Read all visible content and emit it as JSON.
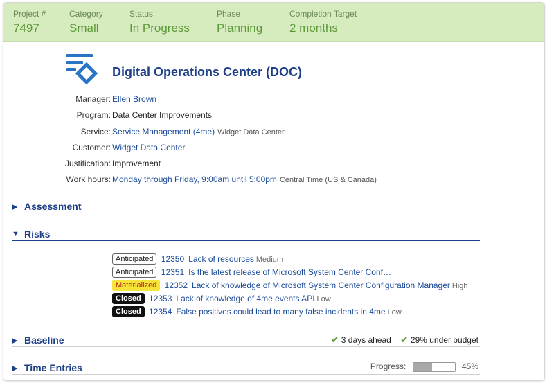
{
  "summary": {
    "project": {
      "label": "Project #",
      "value": "7497"
    },
    "category": {
      "label": "Category",
      "value": "Small"
    },
    "status": {
      "label": "Status",
      "value": "In Progress"
    },
    "phase": {
      "label": "Phase",
      "value": "Planning"
    },
    "completion": {
      "label": "Completion Target",
      "value": "2 months"
    }
  },
  "project": {
    "title": "Digital Operations Center (DOC)",
    "logo_icon": "project-logo-icon"
  },
  "details": {
    "manager": {
      "label": "Manager:",
      "value": "Ellen Brown"
    },
    "program": {
      "label": "Program:",
      "value": "Data Center Improvements"
    },
    "service": {
      "label": "Service:",
      "value": "Service Management (4me)",
      "extra": "Widget Data Center"
    },
    "customer": {
      "label": "Customer:",
      "value": "Widget Data Center"
    },
    "justification": {
      "label": "Justification:",
      "value": "Improvement"
    },
    "work_hours": {
      "label": "Work hours:",
      "value": "Monday through Friday, 9:00am until 5:00pm",
      "extra": "Central Time (US & Canada)"
    }
  },
  "sections": {
    "assessment": {
      "title": "Assessment",
      "icon": "triangle-right-icon"
    },
    "risks": {
      "title": "Risks",
      "icon": "triangle-down-icon"
    },
    "baseline": {
      "title": "Baseline",
      "icon": "triangle-right-icon"
    },
    "time_entries": {
      "title": "Time Entries",
      "icon": "triangle-right-icon"
    }
  },
  "risks": [
    {
      "status": "Anticipated",
      "id": "12350",
      "title": "Lack of resources",
      "severity": "Medium"
    },
    {
      "status": "Anticipated",
      "id": "12351",
      "title": "Is the latest release of Microsoft System Center Configuration Manager stabl…",
      "severity": ""
    },
    {
      "status": "Materialized",
      "id": "12352",
      "title": "Lack of knowledge of Microsoft System Center Configuration Manager",
      "severity": "High"
    },
    {
      "status": "Closed",
      "id": "12353",
      "title": "Lack of knowledge of 4me events API",
      "severity": "Low"
    },
    {
      "status": "Closed",
      "id": "12354",
      "title": "False positives could lead to many false incidents in 4me",
      "severity": "Low"
    }
  ],
  "baseline": {
    "schedule": "3 days ahead",
    "budget": "29% under budget"
  },
  "time_entries": {
    "progress_label": "Progress:",
    "progress_value": "45%",
    "progress_fraction": 0.45
  },
  "colors": {
    "header_bg": "#d6ecbf",
    "header_value": "#5d9a3a",
    "brand_blue": "#1d3f87",
    "link_blue": "#1a4a9a",
    "logo_blue": "#2a74c6",
    "materialized_bg": "#f5e43a"
  }
}
